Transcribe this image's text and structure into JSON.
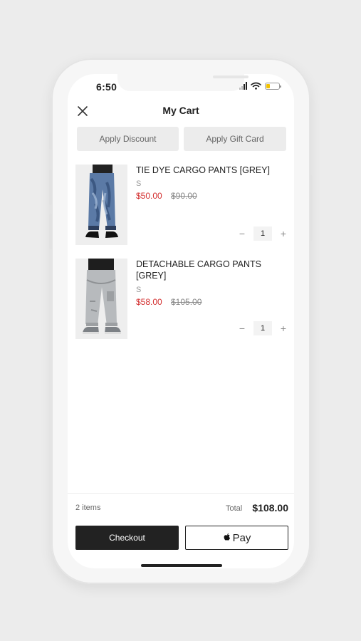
{
  "status_bar": {
    "time": "6:50"
  },
  "header": {
    "title": "My Cart",
    "close_icon": "close-icon"
  },
  "promo": {
    "discount_label": "Apply Discount",
    "gift_card_label": "Apply Gift Card"
  },
  "cart": {
    "items": [
      {
        "name": "TIE DYE CARGO PANTS [GREY]",
        "size": "S",
        "price": "$50.00",
        "original_price": "$90.00",
        "quantity": "1"
      },
      {
        "name": "DETACHABLE CARGO PANTS [GREY]",
        "size": "S",
        "price": "$58.00",
        "original_price": "$105.00",
        "quantity": "1"
      }
    ]
  },
  "summary": {
    "items_count": "2 items",
    "total_label": "Total",
    "total_value": "$108.00"
  },
  "actions": {
    "checkout_label": "Checkout",
    "apple_pay_label": "Pay"
  },
  "colors": {
    "sale_price": "#d32f2f",
    "primary_button": "#222222"
  }
}
